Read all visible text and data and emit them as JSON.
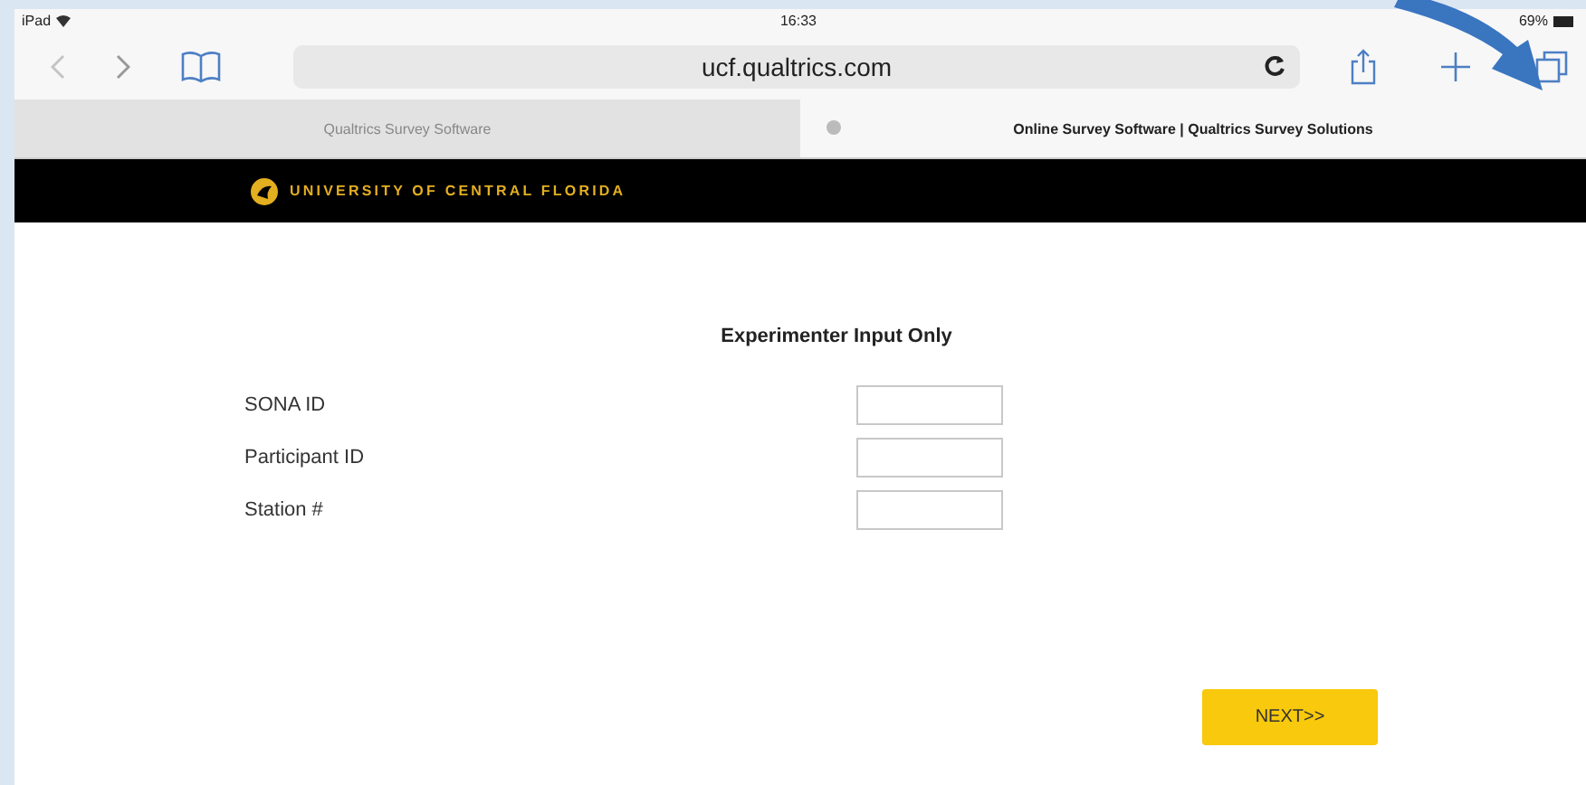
{
  "status_bar": {
    "device": "iPad",
    "time": "16:33",
    "battery": "69%"
  },
  "address_bar": {
    "url": "ucf.qualtrics.com"
  },
  "tabs": [
    {
      "label": "Qualtrics Survey Software",
      "selected": false
    },
    {
      "label": "Online Survey Software | Qualtrics Survey Solutions",
      "selected": true
    }
  ],
  "banner": {
    "title": "UNIVERSITY OF CENTRAL FLORIDA"
  },
  "form": {
    "heading": "Experimenter Input Only",
    "fields": [
      {
        "label": "SONA ID"
      },
      {
        "label": "Participant ID"
      },
      {
        "label": "Station #"
      }
    ]
  },
  "buttons": [
    "NEXT>>"
  ]
}
